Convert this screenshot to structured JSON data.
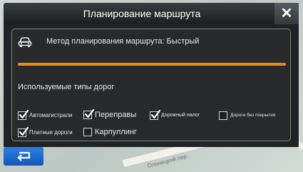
{
  "window": {
    "title": "Планирование маршрута",
    "close_glyph": "✕"
  },
  "route": {
    "method_label": "Метод планирования маршрута: Быстрый",
    "progress": 1.0,
    "progress_color": "#f08a16"
  },
  "road_types": {
    "section_label": "Используемые типы дорог",
    "options": [
      {
        "label": "Автомагистрали",
        "checked": true
      },
      {
        "label": "Переправы",
        "checked": true
      },
      {
        "label": "Дорожный налог",
        "checked": true
      },
      {
        "label": "Дороги без покрытия",
        "checked": false
      },
      {
        "label": "Платные дороги",
        "checked": true
      },
      {
        "label": "Карпуллинг",
        "checked": false
      }
    ]
  },
  "icons": {
    "car": "car-icon",
    "back": "back-arrow-icon",
    "close": "close-icon",
    "check": "check-icon"
  },
  "map": {
    "street_label": "Олонецкий пер."
  },
  "colors": {
    "accent": "#f08a16",
    "back_button": "#1e6bd2",
    "dialog_bg": "#202325"
  }
}
